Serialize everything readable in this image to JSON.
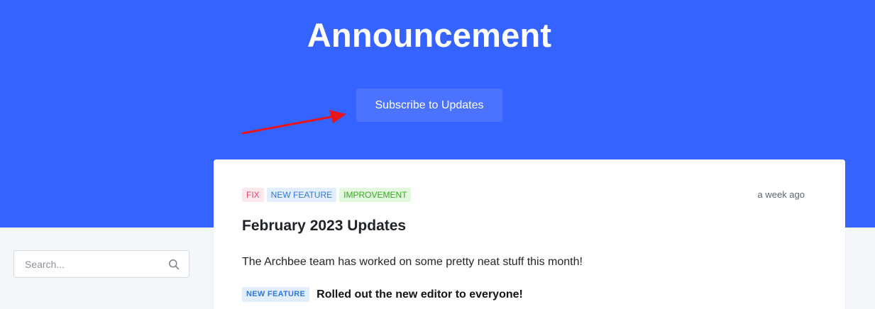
{
  "hero": {
    "title": "Announcement",
    "subscribe_label": "Subscribe to Updates",
    "background_color": "#3563ff",
    "button_color": "#4c73ff"
  },
  "annotation": {
    "type": "red-arrow",
    "color": "#e8141c",
    "points_to": "subscribe-button"
  },
  "sidebar": {
    "search": {
      "placeholder": "Search...",
      "value": "",
      "icon": "search-icon"
    }
  },
  "post": {
    "tags": [
      {
        "label": "FIX",
        "color": "#e0486f"
      },
      {
        "label": "NEW FEATURE",
        "color": "#2f79dd"
      },
      {
        "label": "IMPROVEMENT",
        "color": "#34a822"
      }
    ],
    "timestamp": "a week ago",
    "title": "February 2023 Updates",
    "intro": "The Archbee team has worked on some pretty neat stuff this month!",
    "feature": {
      "tag": "NEW FEATURE",
      "text": "Rolled out the new editor to everyone!"
    }
  }
}
